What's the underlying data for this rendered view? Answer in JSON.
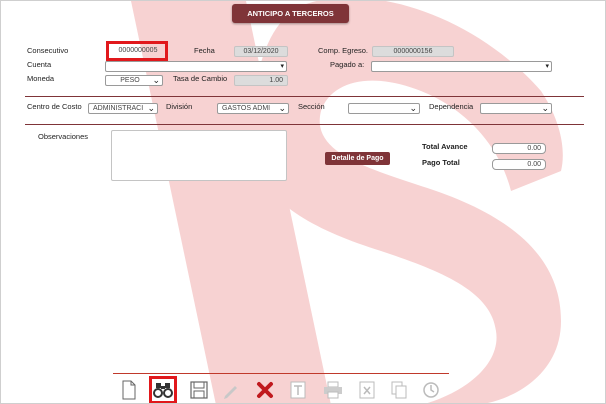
{
  "title": "ANTICIPO A TERCEROS",
  "form": {
    "consecutivo_label": "Consecutivo",
    "consecutivo_value": "0000000005",
    "fecha_label": "Fecha",
    "fecha_value": "03/12/2020",
    "comp_egreso_label": "Comp. Egreso.",
    "comp_egreso_value": "0000000156",
    "cuenta_label": "Cuenta",
    "cuenta_value": "",
    "pagado_label": "Pagado a:",
    "pagado_value": "",
    "moneda_label": "Moneda",
    "moneda_value": "PESO",
    "tasa_label": "Tasa de Cambio",
    "tasa_value": "1.00"
  },
  "costs": {
    "centro_label": "Centro de Costo",
    "centro_value": "ADMINISTRACI",
    "division_label": "División",
    "division_value": "GASTOS ADMI",
    "seccion_label": "Sección",
    "seccion_value": "",
    "dependencia_label": "Dependencia",
    "dependencia_value": ""
  },
  "observaciones_label": "Observaciones",
  "detalle_pago_label": "Detalle de Pago",
  "totals": {
    "avance_label": "Total Avance",
    "avance_value": "0.00",
    "pago_label": "Pago Total",
    "pago_value": "0.00"
  },
  "colors": {
    "accent": "#7f3438",
    "highlight": "#e1181c",
    "watermark": "#f7d4d4"
  },
  "toolbar": [
    "new-document-icon",
    "binoculars-icon",
    "save-icon",
    "edit-pencil-icon",
    "delete-x-icon",
    "text-icon",
    "print-icon",
    "excel-icon",
    "copy-icon",
    "history-icon"
  ]
}
